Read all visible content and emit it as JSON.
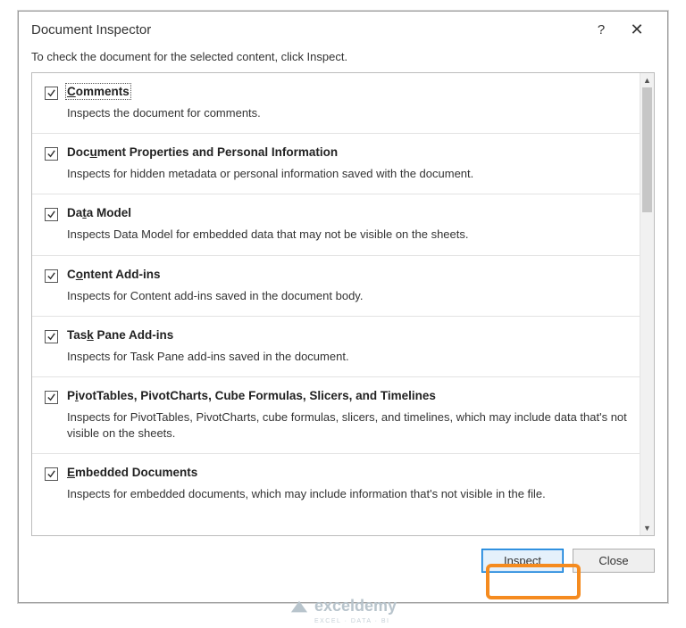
{
  "dialog": {
    "title": "Document Inspector",
    "help_symbol": "?",
    "close_symbol": "✕",
    "instruction": "To check the document for the selected content, click Inspect."
  },
  "items": [
    {
      "checked": true,
      "focused": true,
      "title_pre": "",
      "title_u": "C",
      "title_post": "omments",
      "desc": "Inspects the document for comments."
    },
    {
      "checked": true,
      "focused": false,
      "title_pre": "Doc",
      "title_u": "u",
      "title_post": "ment Properties and Personal Information",
      "desc": "Inspects for hidden metadata or personal information saved with the document."
    },
    {
      "checked": true,
      "focused": false,
      "title_pre": "Da",
      "title_u": "t",
      "title_post": "a Model",
      "desc": "Inspects Data Model for embedded data that may not be visible on the sheets."
    },
    {
      "checked": true,
      "focused": false,
      "title_pre": "C",
      "title_u": "o",
      "title_post": "ntent Add-ins",
      "desc": "Inspects for Content add-ins saved in the document body."
    },
    {
      "checked": true,
      "focused": false,
      "title_pre": "Tas",
      "title_u": "k",
      "title_post": " Pane Add-ins",
      "desc": "Inspects for Task Pane add-ins saved in the document."
    },
    {
      "checked": true,
      "focused": false,
      "title_pre": "P",
      "title_u": "i",
      "title_post": "votTables, PivotCharts, Cube Formulas, Slicers, and Timelines",
      "desc": "Inspects for PivotTables, PivotCharts, cube formulas, slicers, and timelines, which may include data that's not visible on the sheets."
    },
    {
      "checked": true,
      "focused": false,
      "title_pre": "",
      "title_u": "E",
      "title_post": "mbedded Documents",
      "desc": "Inspects for embedded documents, which may include information that's not visible in the file."
    }
  ],
  "buttons": {
    "inspect_pre": "",
    "inspect_u": "I",
    "inspect_post": "nspect",
    "close": "Close"
  },
  "watermark": {
    "text": "exceldemy",
    "sub": "EXCEL · DATA · BI"
  }
}
